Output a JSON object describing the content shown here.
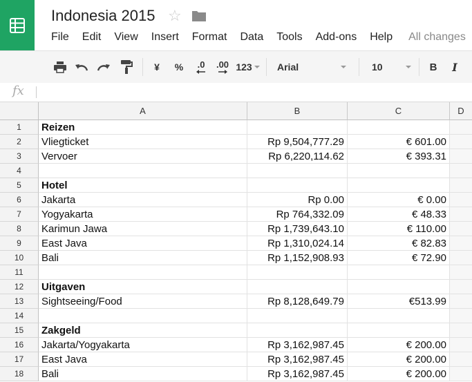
{
  "app": {
    "doc_title": "Indonesia 2015",
    "menu": [
      "File",
      "Edit",
      "View",
      "Insert",
      "Format",
      "Data",
      "Tools",
      "Add-ons",
      "Help"
    ],
    "save_status": "All changes",
    "colors": {
      "brand": "#1fa463",
      "toolbar_bg": "#f5f5f5",
      "header_bg": "#f3f3f3"
    }
  },
  "toolbar": {
    "currency": "¥",
    "percent": "%",
    "decrease_decimals": ".0",
    "increase_decimals": ".00",
    "more_formats": "123",
    "font": "Arial",
    "font_size": "10",
    "bold": "B",
    "italic": "I"
  },
  "formula_bar": {
    "fx": "fx",
    "value": ""
  },
  "columns": [
    "A",
    "B",
    "C",
    "D"
  ],
  "rows": [
    {
      "n": "1",
      "a": "Reizen",
      "b": "",
      "c": "",
      "bold": true
    },
    {
      "n": "2",
      "a": "Vliegticket",
      "b": "Rp 9,504,777.29",
      "c": "€ 601.00"
    },
    {
      "n": "3",
      "a": "Vervoer",
      "b": "Rp 6,220,114.62",
      "c": "€ 393.31"
    },
    {
      "n": "4",
      "a": "",
      "b": "",
      "c": ""
    },
    {
      "n": "5",
      "a": "Hotel",
      "b": "",
      "c": "",
      "bold": true
    },
    {
      "n": "6",
      "a": "Jakarta",
      "b": "Rp 0.00",
      "c": "€ 0.00"
    },
    {
      "n": "7",
      "a": "Yogyakarta",
      "b": "Rp 764,332.09",
      "c": "€ 48.33"
    },
    {
      "n": "8",
      "a": "Karimun Jawa",
      "b": "Rp 1,739,643.10",
      "c": "€ 110.00"
    },
    {
      "n": "9",
      "a": "East Java",
      "b": "Rp 1,310,024.14",
      "c": "€ 82.83"
    },
    {
      "n": "10",
      "a": "Bali",
      "b": "Rp 1,152,908.93",
      "c": "€ 72.90"
    },
    {
      "n": "11",
      "a": "",
      "b": "",
      "c": ""
    },
    {
      "n": "12",
      "a": "Uitgaven",
      "b": "",
      "c": "",
      "bold": true
    },
    {
      "n": "13",
      "a": "Sightseeing/Food",
      "b": "Rp 8,128,649.79",
      "c": "€513.99"
    },
    {
      "n": "14",
      "a": "",
      "b": "",
      "c": ""
    },
    {
      "n": "15",
      "a": "Zakgeld",
      "b": "",
      "c": "",
      "bold": true
    },
    {
      "n": "16",
      "a": "Jakarta/Yogyakarta",
      "b": "Rp 3,162,987.45",
      "c": "€ 200.00"
    },
    {
      "n": "17",
      "a": "East Java",
      "b": "Rp 3,162,987.45",
      "c": "€ 200.00"
    },
    {
      "n": "18",
      "a": "Bali",
      "b": "Rp 3,162,987.45",
      "c": "€ 200.00"
    }
  ]
}
